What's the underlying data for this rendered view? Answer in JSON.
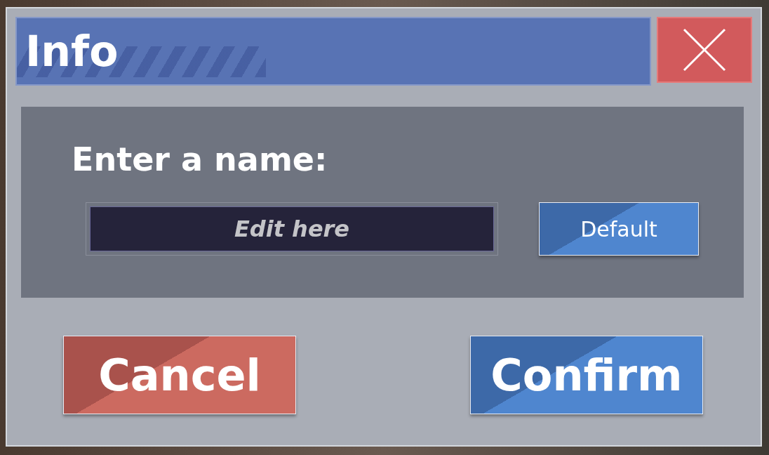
{
  "dialog": {
    "title": "Info",
    "prompt": "Enter a name:",
    "name_field": {
      "placeholder": "Edit here"
    },
    "default_button": "Default",
    "buttons": [
      {
        "label": "Cancel",
        "kind": "cancel"
      },
      {
        "label": "Confirm",
        "kind": "confirm"
      }
    ]
  }
}
